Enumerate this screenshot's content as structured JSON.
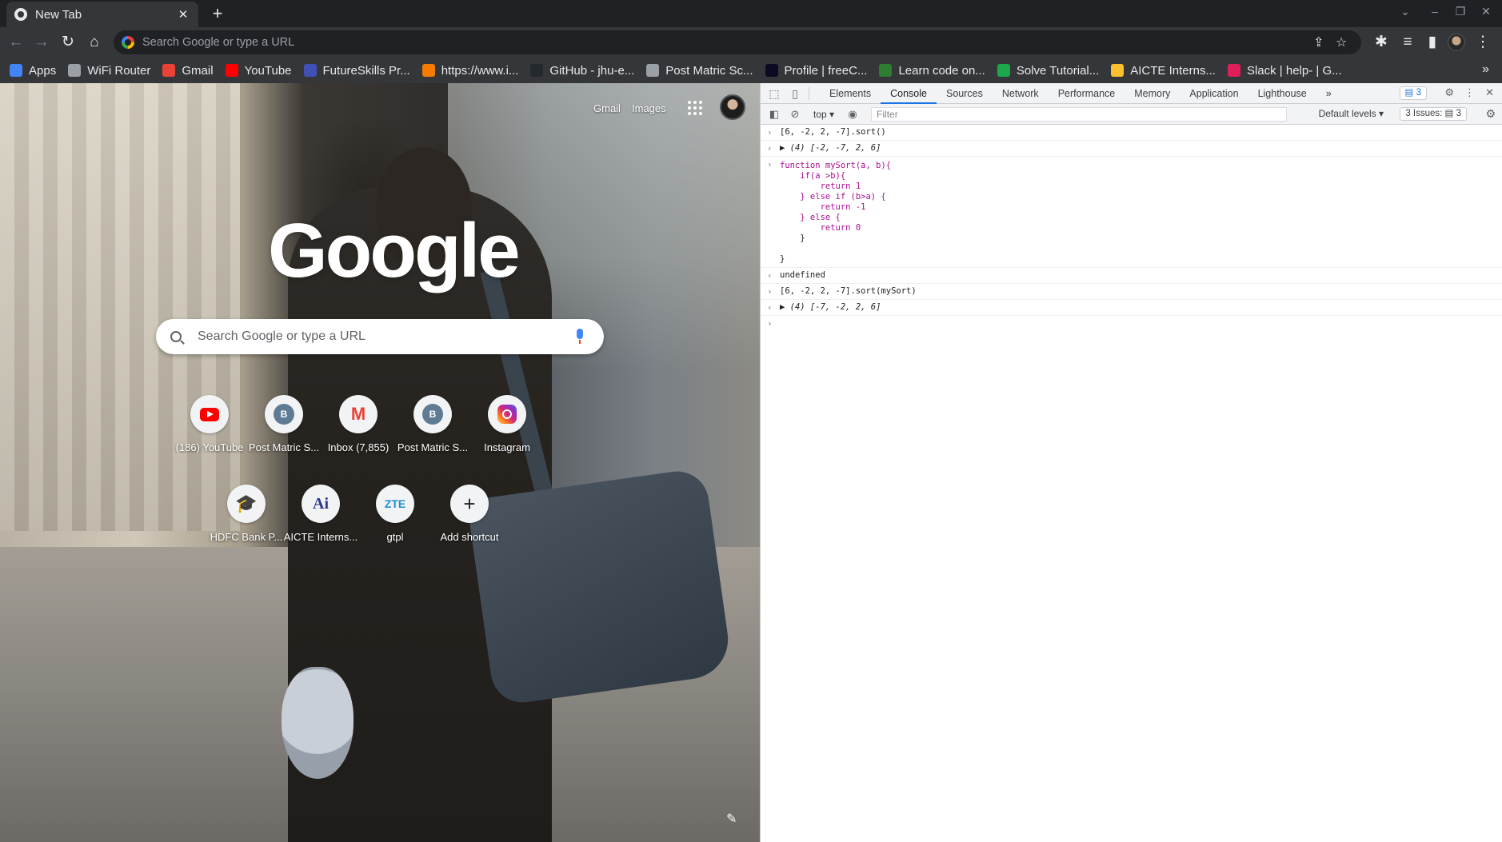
{
  "tab": {
    "title": "New Tab",
    "close": "✕"
  },
  "newtab_label": "+",
  "window_controls": {
    "dropdown": "⌄",
    "minimize": "–",
    "restore": "❐",
    "close": "✕"
  },
  "toolbar": {
    "back": "←",
    "forward": "→",
    "reload": "↻",
    "home": "⌂",
    "omnibox_placeholder": "Search Google or type a URL",
    "share": "⇪",
    "star": "☆",
    "extensions": "✱",
    "media": "≡",
    "sidepanel": "▮",
    "menu": "⋮"
  },
  "bookmarks": [
    {
      "label": "Apps",
      "icon": "apps-icon",
      "color": "#4285f4"
    },
    {
      "label": "WiFi Router",
      "icon": "globe-icon",
      "color": "#9aa0a6"
    },
    {
      "label": "Gmail",
      "icon": "gmail-icon",
      "color": "#ea4335"
    },
    {
      "label": "YouTube",
      "icon": "youtube-icon",
      "color": "#ff0000"
    },
    {
      "label": "FutureSkills Pr...",
      "icon": "futureskills-icon",
      "color": "#3f51b5"
    },
    {
      "label": "https://www.i...",
      "icon": "c-icon",
      "color": "#f57c00"
    },
    {
      "label": "GitHub - jhu-e...",
      "icon": "github-icon",
      "color": "#24292e"
    },
    {
      "label": "Post Matric Sc...",
      "icon": "globe-icon",
      "color": "#9aa0a6"
    },
    {
      "label": "Profile | freeC...",
      "icon": "freecodecamp-icon",
      "color": "#0a0a23"
    },
    {
      "label": "Learn code on...",
      "icon": "code-icon",
      "color": "#2e7d32"
    },
    {
      "label": "Solve Tutorial...",
      "icon": "hackerrank-icon",
      "color": "#1ba94c"
    },
    {
      "label": "AICTE Interns...",
      "icon": "aicte-icon",
      "color": "#fbc02d"
    },
    {
      "label": "Slack | help- | G...",
      "icon": "slack-icon",
      "color": "#e01e5a"
    }
  ],
  "bookmarks_more": "»",
  "ntp": {
    "gmail_link": "Gmail",
    "images_link": "Images",
    "logo": "Google",
    "search_placeholder": "Search Google or type a URL",
    "shortcuts": [
      {
        "label": "(186) YouTube",
        "icon": "youtube-icon"
      },
      {
        "label": "Post Matric S...",
        "icon": "letter-b-icon",
        "letter": "B"
      },
      {
        "label": "Inbox (7,855)",
        "icon": "gmail-icon",
        "letter": "M"
      },
      {
        "label": "Post Matric S...",
        "icon": "letter-b-icon",
        "letter": "B"
      },
      {
        "label": "Instagram",
        "icon": "instagram-icon"
      },
      {
        "label": "HDFC Bank P...",
        "icon": "hdfc-icon",
        "letter": "🎓"
      },
      {
        "label": "AICTE Interns...",
        "icon": "aicte-icon",
        "letter": "Ai"
      },
      {
        "label": "gtpl",
        "icon": "zte-icon",
        "letter": "ZTE"
      },
      {
        "label": "Add shortcut",
        "icon": "plus-icon",
        "letter": "+"
      }
    ],
    "customize": "✎"
  },
  "devtools": {
    "tabs": [
      "Elements",
      "Console",
      "Sources",
      "Network",
      "Performance",
      "Memory",
      "Application",
      "Lighthouse"
    ],
    "active_tab": "Console",
    "more_tabs": "»",
    "messages_badge": "▤ 3",
    "context": "top ▾",
    "filter_placeholder": "Filter",
    "levels": "Default levels ▾",
    "issues": "3 Issues: ▤ 3",
    "prompt": "›",
    "result_arrow": "‹"
  },
  "console": {
    "line1": "[6, -2, 2, -7].sort()",
    "line2": "▶ (4) [-2, -7, 2, 6]",
    "fn": [
      "function mySort(a, b){",
      "    if(a >b){",
      "        return 1",
      "    } else if (b>a) {",
      "        return -1",
      "    } else {",
      "        return 0",
      "    }",
      "",
      "}"
    ],
    "undefined": "undefined",
    "line4": "[6, -2, 2, -7].sort(mySort)",
    "line5": "▶ (4) [-7, -2, 2, 6]"
  }
}
